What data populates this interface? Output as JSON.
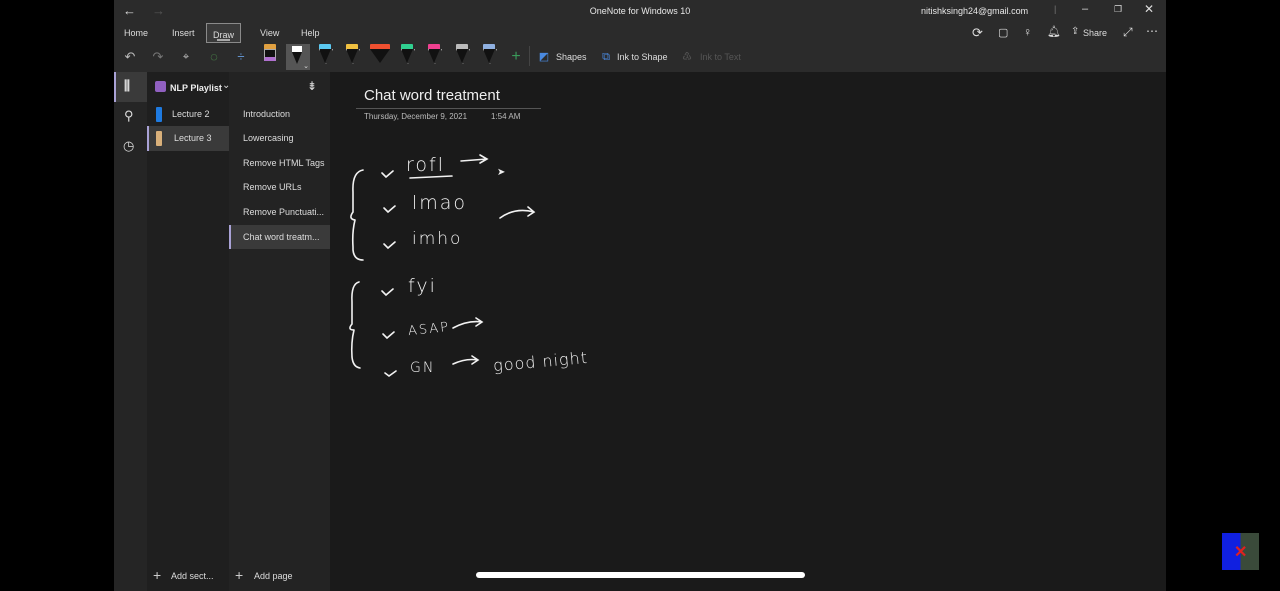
{
  "window": {
    "title": "OneNote for Windows 10",
    "account": "nitishksingh24@gmail.com"
  },
  "ribbon": {
    "tabs": [
      "Home",
      "Insert",
      "Draw",
      "View",
      "Help"
    ],
    "active_tab": "Draw",
    "shapes_label": "Shapes",
    "ink_to_shape_label": "Ink to Shape",
    "ink_to_text_label": "Ink to Text",
    "share_label": "Share",
    "pens": [
      {
        "color": "#b070d0",
        "kind": "pen"
      },
      {
        "color": "#ffffff",
        "kind": "pen-selected"
      },
      {
        "color": "#5bc8f0",
        "kind": "pen"
      },
      {
        "color": "#f0c040",
        "kind": "pen"
      },
      {
        "color": "#f05030",
        "kind": "highlighter"
      },
      {
        "color": "#30d090",
        "kind": "pen"
      },
      {
        "color": "#f04090",
        "kind": "pen"
      },
      {
        "color": "#bbbbbb",
        "kind": "pencil"
      },
      {
        "color": "#8fb0e0",
        "kind": "pencil"
      }
    ]
  },
  "notebook": {
    "name": "NLP Playlist",
    "sections": [
      {
        "label": "Lecture 2",
        "color": "#1e7ae0"
      },
      {
        "label": "Lecture 3",
        "color": "#d9b07a",
        "selected": true
      }
    ],
    "pages": [
      "Introduction",
      "Lowercasing",
      "Remove HTML Tags",
      "Remove URLs",
      "Remove Punctuati...",
      "Chat word treatm..."
    ],
    "selected_page": 5,
    "add_section_label": "Add sect...",
    "add_page_label": "Add page"
  },
  "page": {
    "title": "Chat word treatment",
    "date": "Thursday, December 9, 2021",
    "time": "1:54 AM",
    "ink": {
      "group1": [
        "rofl",
        "lmao",
        "imho"
      ],
      "group2": [
        "fyi",
        "ASAP",
        "GN"
      ],
      "gn_meaning": "good night"
    }
  },
  "accent": "#a9a2d6"
}
